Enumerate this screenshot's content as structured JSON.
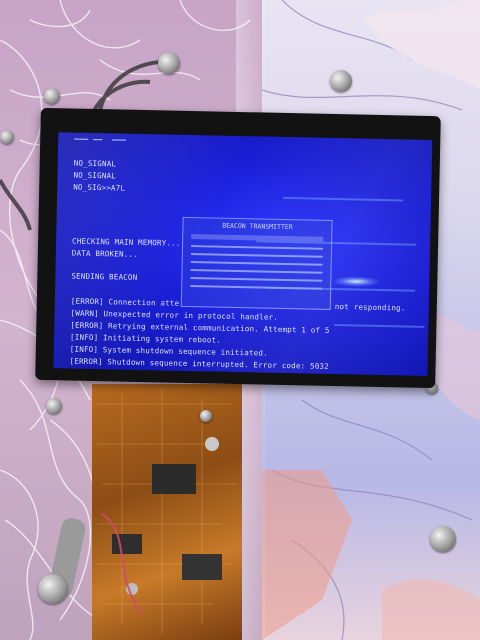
{
  "scene": {
    "kind": "photo",
    "subject": "monitor-with-terminal-on-art-installation",
    "colors": {
      "screen_blue": "#1a1fd6",
      "text": "#d9e0ff",
      "pcb_orange": "#b86a1f",
      "frame": "#121212"
    }
  },
  "terminal": {
    "lines_top": [
      "NO_SIGNAL",
      "NO_SIGNAL",
      "NO_SIG>>A7L"
    ],
    "memory_check": "CHECKING MAIN MEMORY...",
    "data_broken": "DATA BROKEN...",
    "sending": "SENDING BEACON",
    "logs": [
      "[ERROR] Connection atte",
      "[WARN] Unexpected error in protocol handler.",
      "[ERROR] Retrying external communication. Attempt 1 of 5",
      "[INFO] Initiating system reboot.",
      "[INFO] System shutdown sequence initiated.",
      "[ERROR] Shutdown sequence interrupted. Error code: 5032"
    ],
    "log_tail": "not responding."
  },
  "dialog": {
    "title": "BEACON TRANSMITTER"
  }
}
